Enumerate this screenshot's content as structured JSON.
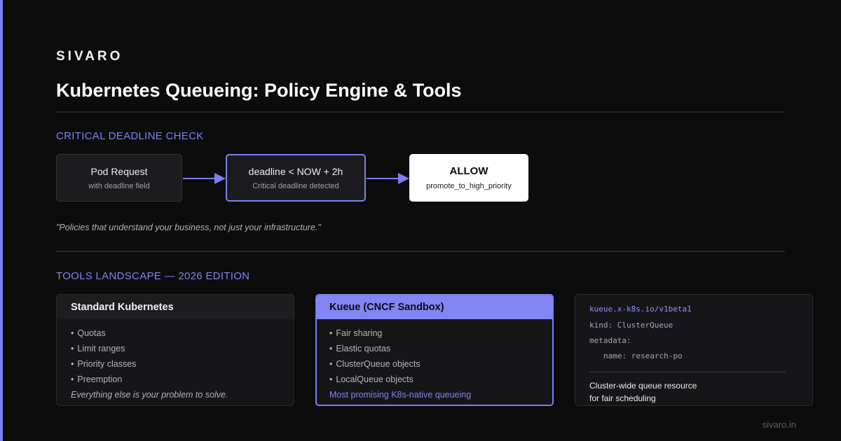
{
  "brand": "SIVARO",
  "title": "Kubernetes Queueing: Policy Engine & Tools",
  "deadline_section": {
    "label": "CRITICAL DEADLINE CHECK",
    "steps": [
      {
        "title": "Pod Request",
        "subtitle": "with deadline field"
      },
      {
        "title": "deadline < NOW + 2h",
        "subtitle": "Critical deadline detected"
      },
      {
        "title": "ALLOW",
        "subtitle": "promote_to_high_priority"
      }
    ],
    "quote": "\"Policies that understand your business, not just your infrastructure.\""
  },
  "tools_section": {
    "label": "TOOLS LANDSCAPE — 2026 EDITION",
    "standard": {
      "title": "Standard Kubernetes",
      "items": [
        "Quotas",
        "Limit ranges",
        "Priority classes",
        "Preemption"
      ],
      "footer": "Everything else is your problem to solve."
    },
    "kueue": {
      "title": "Kueue (CNCF Sandbox)",
      "items": [
        "Fair sharing",
        "Elastic quotas",
        "ClusterQueue objects",
        "LocalQueue objects"
      ],
      "footer": "Most promising K8s-native queueing"
    },
    "code": {
      "api_version": "kueue.x-k8s.io/v1beta1",
      "kind": "kind: ClusterQueue",
      "metadata": "metadata:",
      "name": "name: research-po",
      "description_line1": "Cluster-wide queue resource",
      "description_line2": "for fair scheduling"
    }
  },
  "footer_url": "sivaro.in",
  "colors": {
    "accent": "#7b80f0",
    "background": "#0c0c0d",
    "card": "#161618"
  }
}
